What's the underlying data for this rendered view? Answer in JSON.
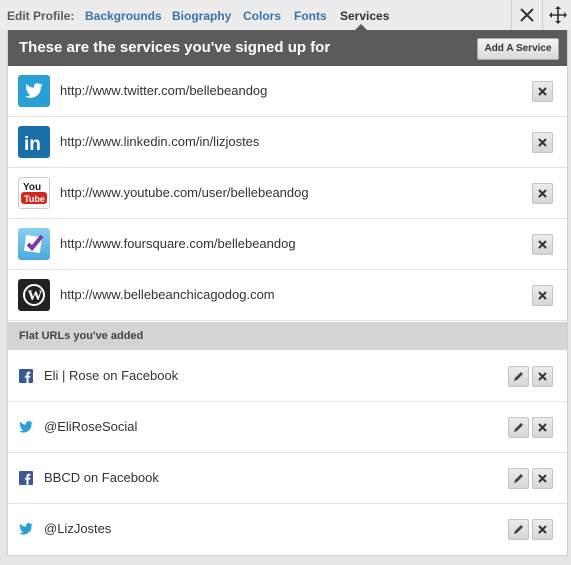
{
  "topbar": {
    "label": "Edit Profile:",
    "tabs": [
      "Backgrounds",
      "Biography",
      "Colors",
      "Fonts",
      "Services"
    ],
    "active_tab": "Services"
  },
  "panel": {
    "title": "These are the services you've signed up for",
    "add_button": "Add A Service"
  },
  "services": [
    {
      "icon": "twitter-icon",
      "url": "http://www.twitter.com/bellebeandog"
    },
    {
      "icon": "linkedin-icon",
      "url": "http://www.linkedin.com/in/lizjostes"
    },
    {
      "icon": "youtube-icon",
      "url": "http://www.youtube.com/user/bellebeandog"
    },
    {
      "icon": "foursquare-icon",
      "url": "http://www.foursquare.com/bellebeandog"
    },
    {
      "icon": "wordpress-icon",
      "url": "http://www.bellebeanchicagodog.com"
    }
  ],
  "flat_section": {
    "title": "Flat URLs you've added",
    "items": [
      {
        "icon": "facebook-icon",
        "label": "Eli | Rose on Facebook"
      },
      {
        "icon": "twitter-icon",
        "label": "@EliRoseSocial"
      },
      {
        "icon": "facebook-icon",
        "label": "BBCD on Facebook"
      },
      {
        "icon": "twitter-icon",
        "label": "@LizJostes"
      }
    ]
  },
  "colors": {
    "header_bg": "#5b5b5b",
    "tab_link": "#3a73a6",
    "twitter": "#2a9fd6",
    "linkedin": "#1a6fa8",
    "youtube": "#d7261b",
    "foursquare": "#7a3ba8",
    "wordpress": "#222222",
    "facebook": "#3b5998"
  }
}
